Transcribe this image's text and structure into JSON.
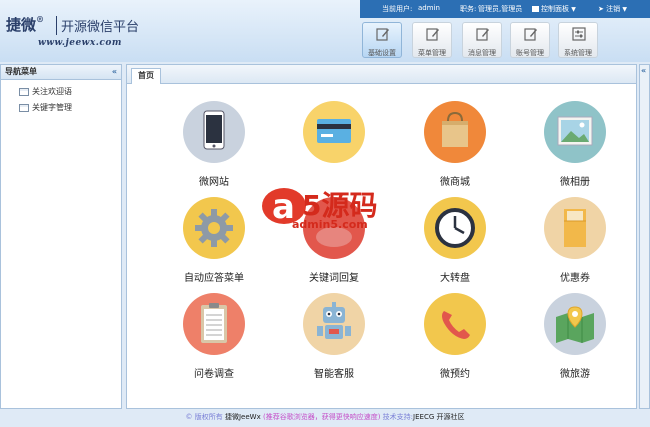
{
  "header": {
    "logo_main": "捷微",
    "logo_reg": "®",
    "logo_sub": "开源微信平台",
    "logo_url": "www.jeewx.com",
    "current_user_label": "当前用户:",
    "current_user": "admin",
    "role_label": "职务:",
    "role": "管理员,管理员",
    "control_panel": "控制面板",
    "logout": "注销"
  },
  "nav": [
    {
      "label": "基础设置",
      "active": true
    },
    {
      "label": "菜单管理",
      "active": false
    },
    {
      "label": "消息管理",
      "active": false
    },
    {
      "label": "账号管理",
      "active": false
    },
    {
      "label": "系统管理",
      "active": false
    }
  ],
  "sidebar": {
    "title": "导航菜单",
    "collapse": "«",
    "items": [
      {
        "label": "关注欢迎语"
      },
      {
        "label": "关键字管理"
      }
    ]
  },
  "main": {
    "tab": "首页",
    "apps": [
      {
        "label": "微网站",
        "icon": "phone-icon",
        "color": "#c9d2de"
      },
      {
        "label": "",
        "icon": "card-icon",
        "color": "#f8d36a"
      },
      {
        "label": "微商城",
        "icon": "shopping-bag-icon",
        "color": "#f0883a"
      },
      {
        "label": "微相册",
        "icon": "photo-icon",
        "color": "#8fc3c8"
      },
      {
        "label": "自动应答菜单",
        "icon": "gear-icon",
        "color": "#f2c74d"
      },
      {
        "label": "关键词回复",
        "icon": "speech-icon",
        "color": "#e2574c"
      },
      {
        "label": "大转盘",
        "icon": "clock-icon",
        "color": "#f2c74d"
      },
      {
        "label": "优惠券",
        "icon": "envelope-icon",
        "color": "#f0d4a6"
      },
      {
        "label": "问卷调查",
        "icon": "clipboard-icon",
        "color": "#ee8069"
      },
      {
        "label": "智能客服",
        "icon": "robot-icon",
        "color": "#f0d4a6"
      },
      {
        "label": "微预约",
        "icon": "telephone-icon",
        "color": "#f2c74d"
      },
      {
        "label": "微旅游",
        "icon": "map-icon",
        "color": "#c9d2de"
      }
    ]
  },
  "watermark": {
    "brand": "5源码",
    "url": "admin5.com"
  },
  "footer": {
    "copyright": "© 版权所有",
    "owner": "捷微JeeWx",
    "tip": "(推荐谷歌浏览器，获得更快响应速度)",
    "support_label": "技术支持:",
    "support": "JEECG 开源社区"
  }
}
